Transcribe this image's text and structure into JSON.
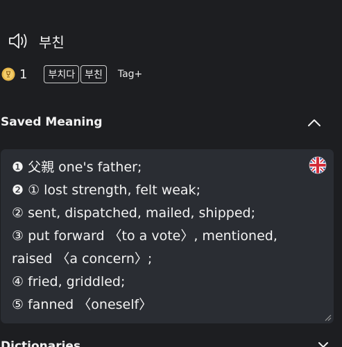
{
  "word": {
    "text": "부친",
    "speaker_icon": "speaker-icon"
  },
  "stats": {
    "medal_icon": "medal-icon",
    "count": "1"
  },
  "tags": {
    "items": [
      "부치다",
      "부친"
    ],
    "add_label": "Tag+"
  },
  "saved_meaning": {
    "title": "Saved Meaning",
    "toggle_icon": "chevron-up-icon",
    "flag_icon": "uk-flag-icon",
    "lines": [
      "❶ 父親  one's father;",
      "❷ ① lost strength, felt weak;",
      "② sent, dispatched, mailed, shipped;",
      "③ put forward 〈to a vote〉, mentioned,",
      "raised 〈a concern〉;",
      "④ fried, griddled;",
      "⑤ fanned 〈oneself〉"
    ]
  },
  "next_section": {
    "title": "Dictionaries",
    "toggle_icon": "chevron-down-icon"
  },
  "colors": {
    "background": "#1d1e21",
    "card": "#2a2d33",
    "text": "#f2f2f2",
    "medal": "#e8b84a"
  }
}
